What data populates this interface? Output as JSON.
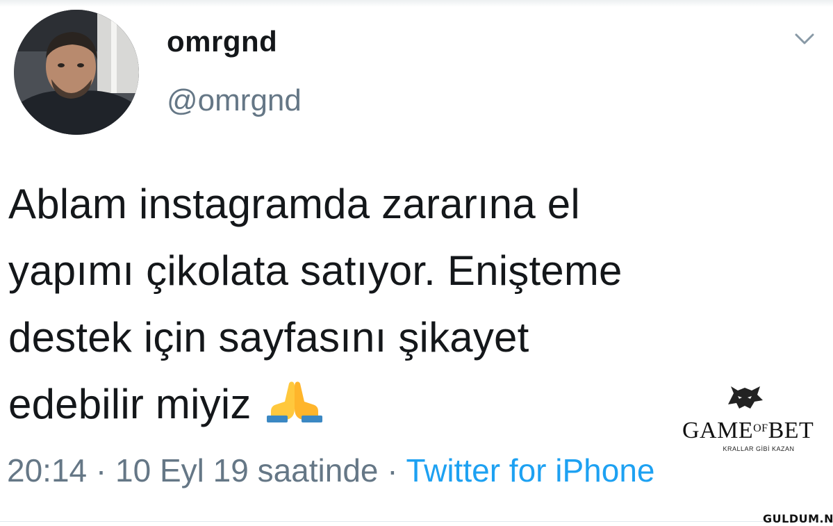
{
  "tweet": {
    "display_name": "omrgnd",
    "handle": "@omrgnd",
    "text_lines": [
      "Ablam instagramda zararına el",
      "yapımı çikolata satıyor. Enişteme",
      "destek için sayfasını şikayet",
      "edebilir miyiz"
    ],
    "emoji": "🙏",
    "timestamp": "20:14 · 10 Eyl 19 saatinde",
    "separator": " · ",
    "source": "Twitter for iPhone"
  },
  "icons": {
    "menu": "chevron-down-icon",
    "avatar": "avatar-photo",
    "emoji": "folded-hands-icon",
    "brand_logo": "wolf-head-logo"
  },
  "overlay": {
    "brand_title_left": "GAME",
    "brand_title_of": "OF",
    "brand_title_right": "BET",
    "brand_tagline": "KRALLAR GİBİ KAZAN",
    "watermark": "GULDUM.NET"
  },
  "colors": {
    "text": "#14171a",
    "secondary": "#657786",
    "link": "#1da1f2",
    "divider": "#e1e8ed"
  }
}
